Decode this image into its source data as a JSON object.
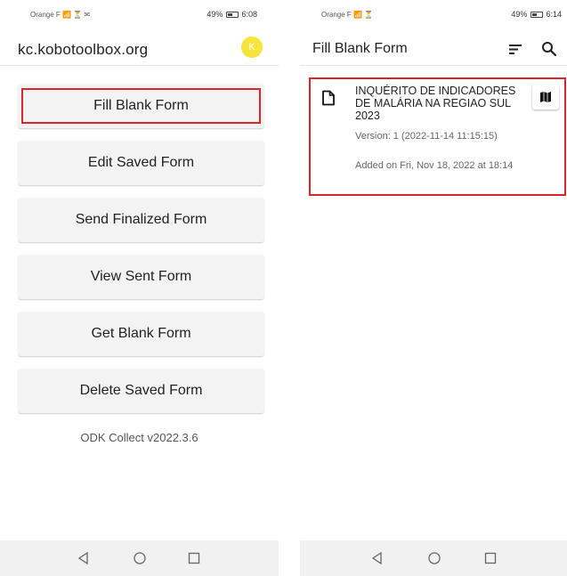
{
  "left_screen": {
    "status_bar": {
      "carrier": "Orange F",
      "indicators": "📶 ⏳ ✉",
      "battery": "49%",
      "time": "6:08"
    },
    "app_bar": {
      "title": "kc.kobotoolbox.org",
      "avatar_letter": "K",
      "avatar_color": "#f6e43b"
    },
    "menu": [
      {
        "label": "Fill Blank Form",
        "highlighted": true
      },
      {
        "label": "Edit Saved Form"
      },
      {
        "label": "Send Finalized Form"
      },
      {
        "label": "View Sent Form"
      },
      {
        "label": "Get Blank Form"
      },
      {
        "label": "Delete Saved Form"
      }
    ],
    "version": "ODK Collect v2022.3.6",
    "nav_icons": [
      "back-triangle-icon",
      "home-circle-icon",
      "recents-square-icon"
    ]
  },
  "right_screen": {
    "status_bar": {
      "carrier": "Orange F",
      "indicators": "📶 ⏳",
      "battery": "49%",
      "time": "6:14"
    },
    "app_bar": {
      "title": "Fill Blank Form",
      "icons": [
        "sort-icon",
        "search-icon"
      ]
    },
    "form_item": {
      "name": "INQUÉRITO DE INDICADORES DE MALÁRIA NA REGIAO SUL 2023",
      "version": "Version: 1 (2022-11-14 11:15:15)",
      "added": "Added on Fri, Nov 18, 2022 at 18:14",
      "icon": "document-icon",
      "action_icon": "map-icon"
    },
    "nav_icons": [
      "back-triangle-icon",
      "home-circle-icon",
      "recents-square-icon"
    ]
  },
  "colors": {
    "highlight_border": "#d9262b",
    "button_bg": "#f3f3f3",
    "nav_bg": "#f1f1f1"
  }
}
